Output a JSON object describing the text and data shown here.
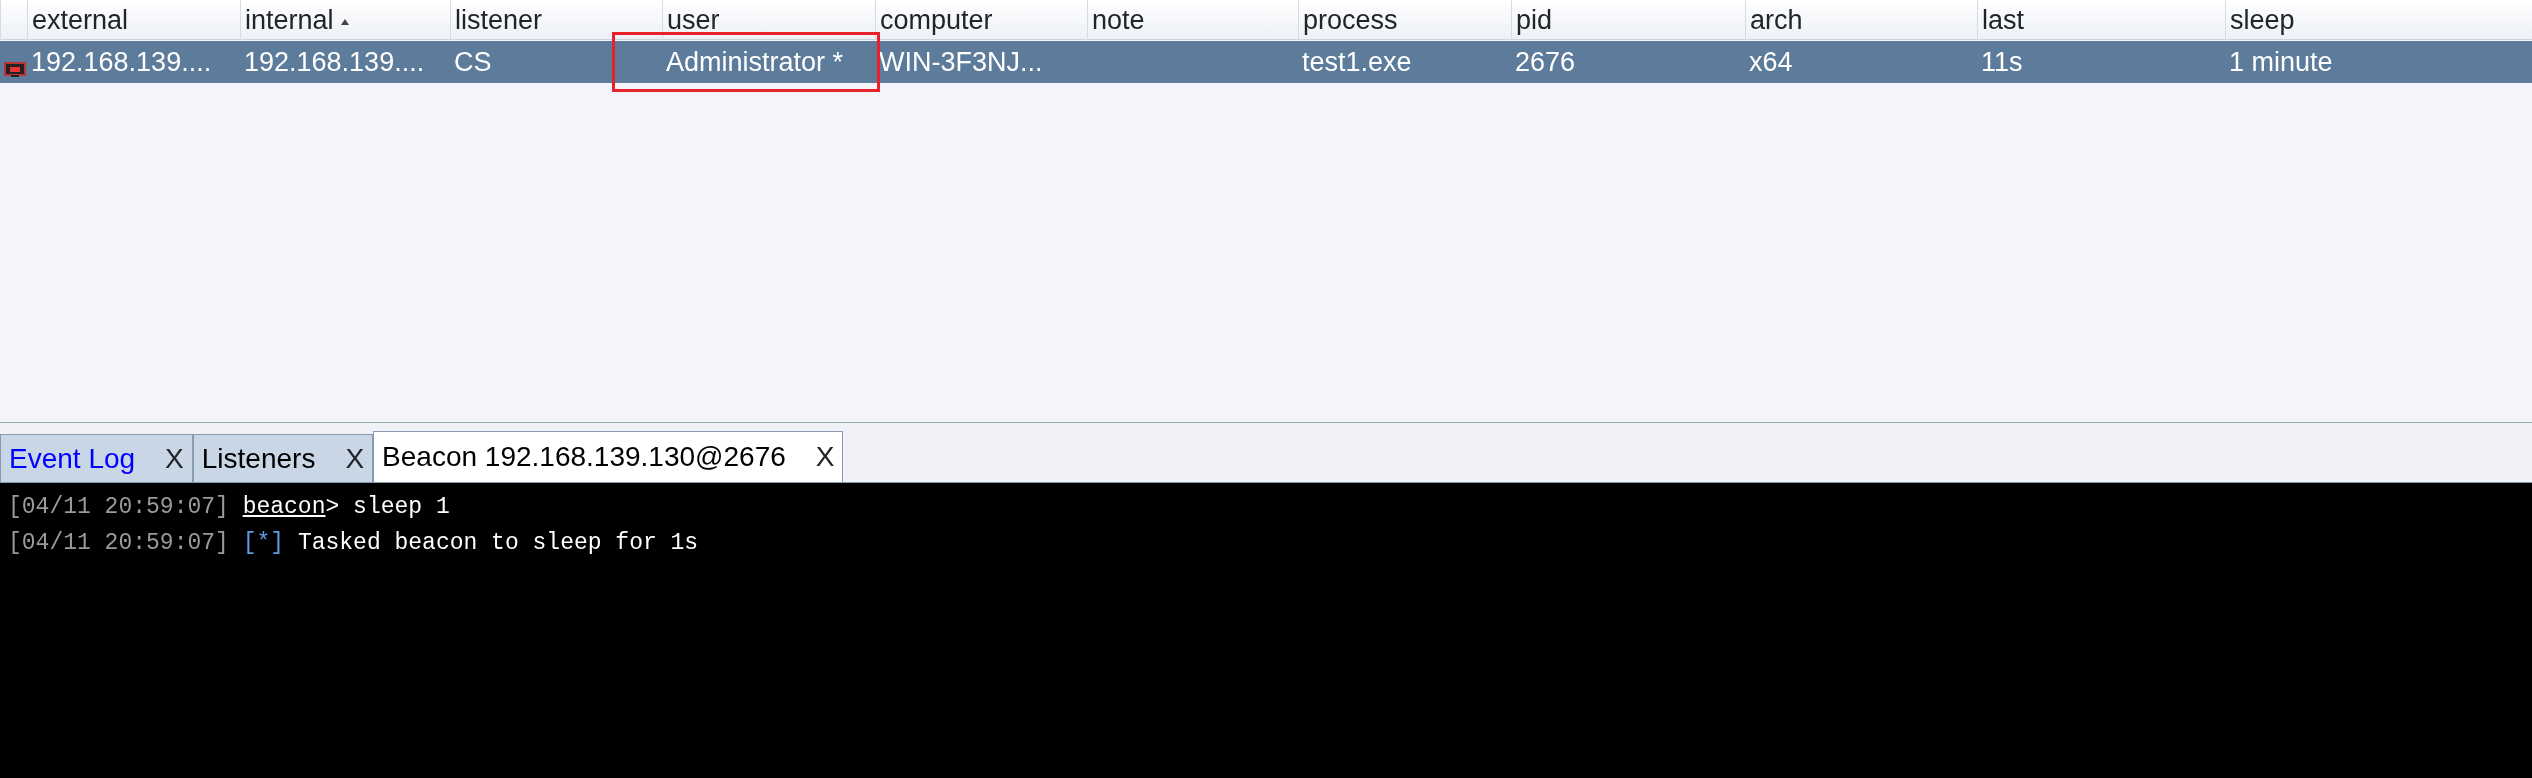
{
  "table": {
    "columns": [
      {
        "label": "external",
        "sorted": false
      },
      {
        "label": "internal",
        "sorted": true
      },
      {
        "label": "listener",
        "sorted": false
      },
      {
        "label": "user",
        "sorted": false
      },
      {
        "label": "computer",
        "sorted": false
      },
      {
        "label": "note",
        "sorted": false
      },
      {
        "label": "process",
        "sorted": false
      },
      {
        "label": "pid",
        "sorted": false
      },
      {
        "label": "arch",
        "sorted": false
      },
      {
        "label": "last",
        "sorted": false
      },
      {
        "label": "sleep",
        "sorted": false
      }
    ],
    "rows": [
      {
        "selected": true,
        "cells": [
          {
            "text": "192.168.139....",
            "boxed": false
          },
          {
            "text": "192.168.139....",
            "boxed": false
          },
          {
            "text": "CS",
            "boxed": false
          },
          {
            "text": "Administrator *",
            "boxed": true
          },
          {
            "text": "WIN-3F3NJ...",
            "boxed": false
          },
          {
            "boxed": false
          },
          {
            "text": "test1.exe",
            "boxed": false
          },
          {
            "text": "2676",
            "boxed": false
          },
          {
            "text": "x64",
            "boxed": false
          },
          {
            "text": "11s",
            "boxed": false
          },
          {
            "text": " 1 minute",
            "boxed": false
          }
        ]
      }
    ]
  },
  "tabs": [
    {
      "label": "Event Log",
      "close": "X",
      "selected": false,
      "color": "#0000ff"
    },
    {
      "label": "Listeners",
      "close": "X",
      "selected": false,
      "color": "#000000"
    },
    {
      "label": "Beacon 192.168.139.130@2676",
      "close": "X",
      "selected": true,
      "color": "#000000"
    }
  ],
  "console": [
    [
      {
        "kind": "time",
        "text": "[04/11 20:59:07]"
      },
      {
        "kind": "prompt",
        "text": "beacon"
      },
      {
        "kind": "text",
        "text": "> sleep 1"
      }
    ],
    [
      {
        "kind": "time",
        "text": "[04/11 20:59:07]"
      },
      {
        "kind": "marker",
        "text": "[*]"
      },
      {
        "kind": "text",
        "text": "Tasked beacon to sleep for 1s"
      }
    ]
  ]
}
